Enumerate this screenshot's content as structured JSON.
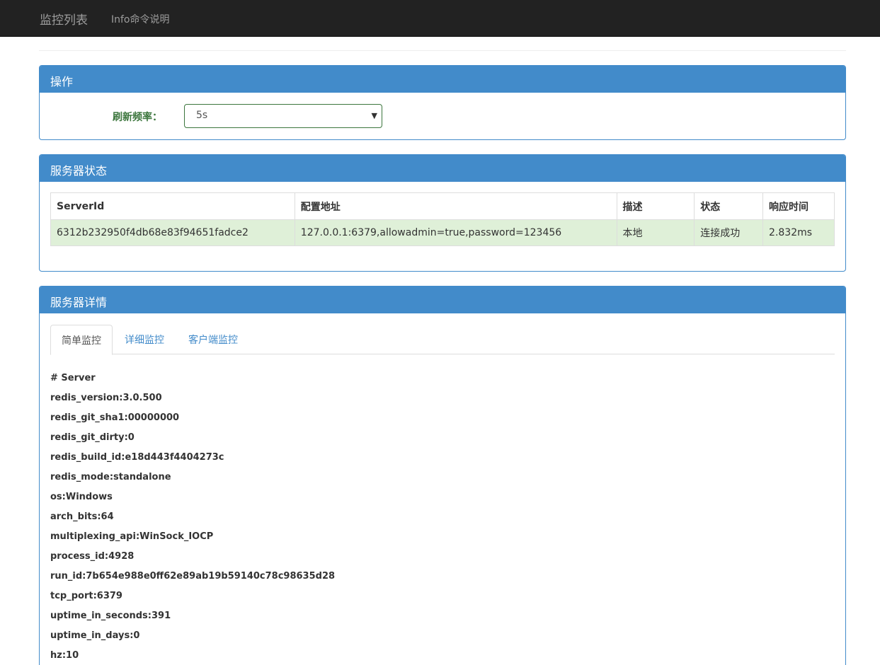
{
  "navbar": {
    "brand": "监控列表",
    "link": "Info命令说明"
  },
  "ops_panel": {
    "title": "操作",
    "refresh_label": "刷新频率：",
    "refresh_value": "5s"
  },
  "status_panel": {
    "title": "服务器状态",
    "headers": [
      "ServerId",
      "配置地址",
      "描述",
      "状态",
      "响应时间"
    ],
    "row": [
      "6312b232950f4db68e83f94651fadce2",
      "127.0.0.1:6379,allowadmin=true,password=123456",
      "本地",
      "连接成功",
      "2.832ms"
    ]
  },
  "detail_panel": {
    "title": "服务器详情",
    "tabs": [
      "简单监控",
      "详细监控",
      "客户端监控"
    ],
    "active_tab": 0,
    "info_lines": [
      "# Server",
      "redis_version:3.0.500",
      "redis_git_sha1:00000000",
      "redis_git_dirty:0",
      "redis_build_id:e18d443f4404273c",
      "redis_mode:standalone",
      "os:Windows",
      "arch_bits:64",
      "multiplexing_api:WinSock_IOCP",
      "process_id:4928",
      "run_id:7b654e988e0ff62e89ab19b59140c78c98635d28",
      "tcp_port:6379",
      "uptime_in_seconds:391",
      "uptime_in_days:0",
      "hz:10"
    ]
  },
  "colors": {
    "navbar_bg": "#222222",
    "panel_primary": "#428bca",
    "success_row": "#dff0d8",
    "success_text": "#3c763d"
  }
}
